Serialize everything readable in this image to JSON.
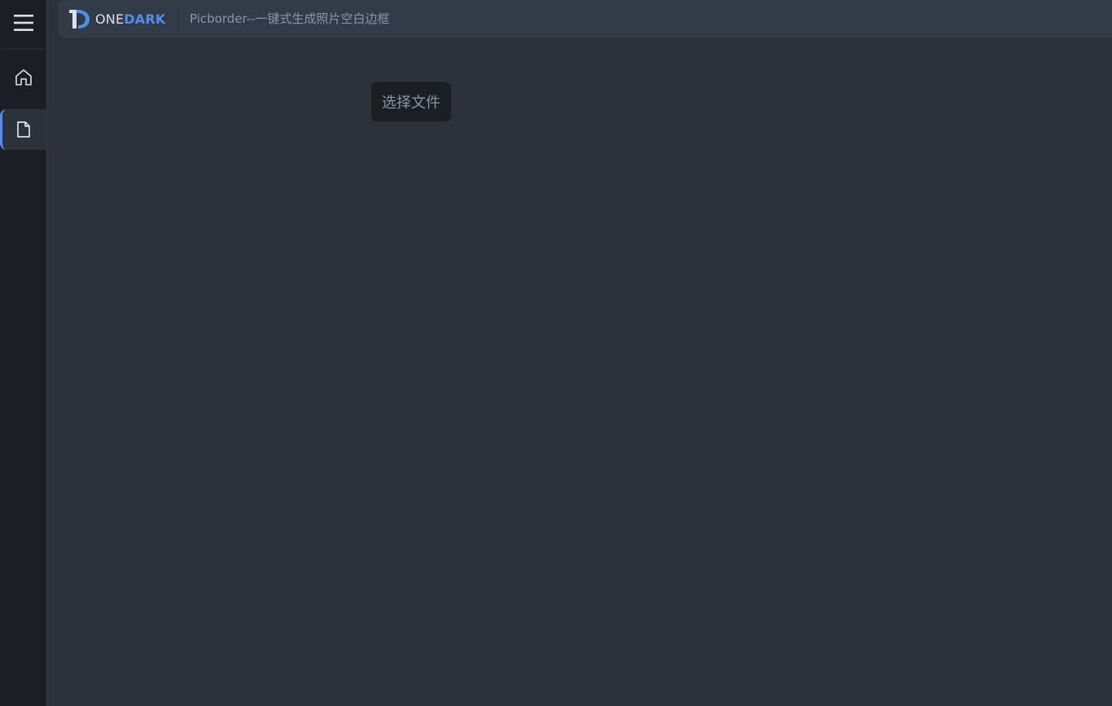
{
  "app": {
    "logo": {
      "part1": "ONE",
      "part2": "DARK"
    },
    "title": "Picborder--一键式生成照片空白边框"
  },
  "sidebar": {
    "items": [
      {
        "name": "menu",
        "icon": "hamburger-menu-icon"
      },
      {
        "name": "home",
        "icon": "home-icon"
      },
      {
        "name": "page",
        "icon": "file-icon",
        "active": true
      }
    ]
  },
  "main": {
    "select_file_label": "选择文件"
  },
  "colors": {
    "background": "#2c313c",
    "sidebar": "#1b1e23",
    "titlebar": "#343b48",
    "accent": "#568af2",
    "text_muted": "#8a95aa"
  }
}
